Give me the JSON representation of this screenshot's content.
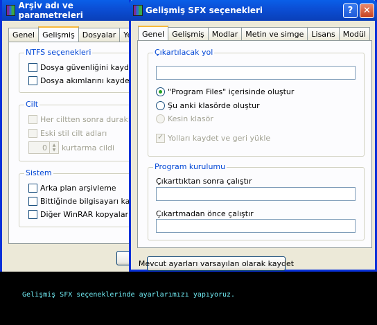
{
  "back_window": {
    "title": "Arşiv adı ve parametreleri",
    "tabs": [
      "Genel",
      "Gelişmiş",
      "Dosyalar",
      "Yede"
    ],
    "ntfs": {
      "title": "NTFS seçenekleri",
      "items": [
        "Dosya güvenliğini kaydet",
        "Dosya akımlarını kaydet"
      ]
    },
    "cilt": {
      "title": "Cilt",
      "items": [
        "Her ciltten sonra duraklat",
        "Eski stil cilt adları"
      ],
      "spin_value": "0",
      "spin_label": "kurtarma cildi"
    },
    "sistem": {
      "title": "Sistem",
      "items": [
        "Arka plan arşivleme",
        "Bittiğinde bilgisayarı kapat",
        "Diğer WinRAR kopyaları etk"
      ]
    }
  },
  "front_window": {
    "title": "Gelişmiş SFX seçenekleri",
    "help": "?",
    "close": "✕",
    "tabs": [
      "Genel",
      "Gelişmiş",
      "Modlar",
      "Metin ve simge",
      "Lisans",
      "Modül"
    ],
    "extract_path": {
      "title": "Çıkartılacak yol",
      "value": "",
      "options": [
        "\"Program Files\" içerisinde oluştur",
        "Şu anki klasörde oluştur",
        "Kesin klasör"
      ],
      "save_paths": "Yolları kaydet ve geri yükle"
    },
    "setup": {
      "title": "Program kurulumu",
      "run_after_label": "Çıkarttıktan sonra çalıştır",
      "run_after_value": "",
      "run_before_label": "Çıkartmadan önce çalıştır",
      "run_before_value": ""
    },
    "save_defaults": "Mevcut ayarları varsayılan olarak kaydet"
  },
  "caption": "Gelişmiş SFX seçeneklerinde ayarlarımızı yapıyoruz.",
  "colors": {
    "title_blue": "#0a4fd6",
    "group_title": "#0046d5",
    "caption_text": "#6fe8f0"
  }
}
